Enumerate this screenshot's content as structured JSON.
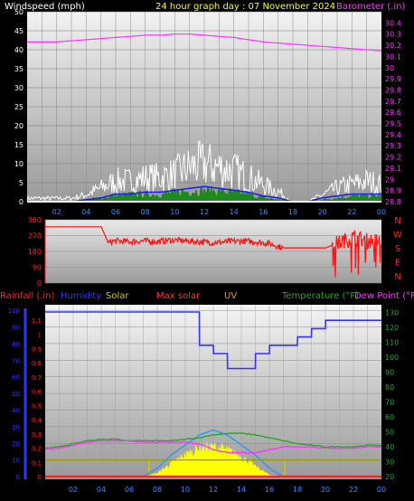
{
  "window": {
    "title": "24 hour graph day : 07 November 2024"
  },
  "colors": {
    "background": "#000000",
    "wind_label": "#ffffff",
    "title": "#ffff00",
    "barometer": "#ff33ff",
    "wind_gust": "#ffffff",
    "wind_avg": "#1a1aff",
    "wind_speed": "#118811",
    "direction": "#ff1111",
    "direction_axis": "#ff2222",
    "rainfall": "#ff2222",
    "humidity": "#3333ff",
    "solar": "#ffff00",
    "max_solar": "#ff3333",
    "uv": "#ff9900",
    "temperature": "#22aa22",
    "dewpoint": "#ff33ff",
    "max_solar_curve": "#3399ee"
  },
  "chart_data": [
    {
      "type": "line",
      "name": "wind-barometer",
      "title": "24 hour graph day : 07 November 2024",
      "ylabel": "Windspeed (mph)",
      "y2label": "Barometer (.in)",
      "x_ticks": [
        "02",
        "04",
        "06",
        "08",
        "10",
        "12",
        "14",
        "16",
        "18",
        "20",
        "22",
        "00"
      ],
      "ylim": [
        0,
        50
      ],
      "y_ticks": [
        0,
        5,
        10,
        15,
        20,
        25,
        30,
        35,
        40,
        45,
        50
      ],
      "y2lim": [
        28.8,
        30.5
      ],
      "y2_ticks": [
        "28.8",
        "28.9",
        "29",
        "29.1",
        "29.2",
        "29.3",
        "29.4",
        "29.5",
        "29.6",
        "29.7",
        "29.8",
        "29.9",
        "30",
        "30.1",
        "30.2",
        "30.3",
        "30.4"
      ],
      "series": [
        {
          "key": "barometer",
          "axis": "y2",
          "x": [
            0,
            1,
            2,
            3,
            4,
            5,
            6,
            7,
            8,
            9,
            10,
            11,
            12,
            13,
            14,
            15,
            16,
            17,
            18,
            19,
            20,
            21,
            22,
            23,
            24
          ],
          "values": [
            30.23,
            30.23,
            30.23,
            30.24,
            30.25,
            30.26,
            30.27,
            30.28,
            30.29,
            30.29,
            30.3,
            30.3,
            30.29,
            30.28,
            30.27,
            30.25,
            30.23,
            30.22,
            30.21,
            30.2,
            30.19,
            30.18,
            30.17,
            30.16,
            30.15
          ]
        },
        {
          "key": "wind_gust",
          "axis": "y",
          "x": [
            0,
            1,
            2,
            3,
            4,
            5,
            6,
            7,
            8,
            9,
            10,
            11,
            12,
            13,
            14,
            15,
            16,
            17,
            18,
            19,
            20,
            21,
            22,
            23,
            24
          ],
          "values": [
            1,
            1,
            1,
            1,
            2,
            4,
            6,
            6,
            7,
            7,
            8,
            10,
            11,
            10,
            9,
            7,
            5,
            3,
            0,
            0,
            2,
            4,
            5,
            6,
            5
          ]
        },
        {
          "key": "wind_avg",
          "axis": "y",
          "x": [
            0,
            1,
            2,
            3,
            4,
            5,
            6,
            7,
            8,
            9,
            10,
            11,
            12,
            13,
            14,
            15,
            16,
            17,
            18,
            19,
            20,
            21,
            22,
            23,
            24
          ],
          "values": [
            0,
            0,
            0,
            0,
            0.5,
            1,
            2,
            2,
            2.5,
            2.5,
            3,
            3.5,
            4,
            3.5,
            3,
            2.5,
            1.5,
            1,
            0,
            0,
            1,
            1.5,
            2,
            2,
            2
          ]
        },
        {
          "key": "wind_speed",
          "axis": "y",
          "x": [
            0,
            1,
            2,
            3,
            4,
            5,
            6,
            7,
            8,
            9,
            10,
            11,
            12,
            13,
            14,
            15,
            16,
            17,
            18,
            19,
            20,
            21,
            22,
            23,
            24
          ],
          "values": [
            0,
            0,
            0,
            0,
            0.5,
            1,
            1.5,
            2,
            2,
            2,
            2.5,
            3,
            3,
            3,
            2.5,
            2,
            1,
            0.5,
            0,
            0,
            0.5,
            1,
            1.5,
            1.5,
            1.5
          ]
        }
      ]
    },
    {
      "type": "line",
      "name": "wind-direction",
      "ylabel": "",
      "y_ticks": [
        0,
        90,
        180,
        270,
        360
      ],
      "y2_labels": [
        "N",
        "W",
        "S",
        "E",
        "N"
      ],
      "ylim": [
        0,
        360
      ],
      "series": [
        {
          "key": "direction",
          "x": [
            0,
            1,
            2,
            3,
            4,
            4.5,
            5,
            6,
            7,
            8,
            9,
            10,
            11,
            12,
            13,
            14,
            15,
            16,
            17,
            18,
            19,
            20,
            21,
            22,
            23,
            24
          ],
          "values": [
            320,
            320,
            320,
            320,
            320,
            230,
            240,
            235,
            240,
            235,
            245,
            240,
            235,
            230,
            235,
            240,
            235,
            225,
            200,
            200,
            200,
            200,
            230,
            260,
            240,
            240
          ]
        }
      ]
    },
    {
      "type": "line",
      "name": "rain-humidity-solar-temp",
      "legend": [
        "Rainfall (.in)",
        "Humidity",
        "Solar",
        "Max solar",
        "UV",
        "Temperature (°F)",
        "Dew Point (°F)"
      ],
      "y_ticks": [
        0,
        10,
        20,
        30,
        40,
        50,
        60,
        70,
        80,
        90,
        100
      ],
      "rain_ticks": [
        "0",
        "0.1",
        "0.2",
        "0.3",
        "0.4",
        "0.5",
        "0.6",
        "0.7",
        "0.8",
        "0.9",
        "1",
        "1.1"
      ],
      "temp_ticks": [
        20,
        30,
        40,
        50,
        60,
        70,
        80,
        90,
        100,
        110,
        120,
        130
      ],
      "series": [
        {
          "key": "humidity",
          "x": [
            0,
            1,
            2,
            3,
            4,
            5,
            6,
            7,
            8,
            9,
            10,
            11,
            11.01,
            12,
            12.01,
            13,
            13.01,
            15,
            15.01,
            16,
            16.01,
            18,
            18.01,
            19,
            19.01,
            20,
            20.01,
            24
          ],
          "values": [
            99,
            99,
            99,
            99,
            99,
            99,
            99,
            99,
            99,
            99,
            99,
            99,
            79,
            79,
            74,
            74,
            65,
            65,
            74,
            74,
            79,
            79,
            84,
            84,
            89,
            89,
            94,
            94
          ]
        },
        {
          "key": "temperature",
          "x": [
            0,
            1,
            2,
            3,
            4,
            5,
            6,
            7,
            8,
            9,
            10,
            11,
            12,
            13,
            14,
            15,
            16,
            17,
            18,
            19,
            20,
            21,
            22,
            23,
            24
          ],
          "values": [
            39,
            40,
            42,
            44,
            45,
            45,
            44,
            44,
            44,
            44,
            45,
            46,
            48,
            49,
            49,
            48,
            46,
            44,
            42,
            41,
            40,
            40,
            40,
            41,
            41
          ]
        },
        {
          "key": "dewpoint",
          "x": [
            0,
            1,
            2,
            3,
            4,
            5,
            6,
            7,
            8,
            9,
            10,
            11,
            12,
            13,
            14,
            15,
            16,
            17,
            18,
            19,
            20,
            21,
            22,
            23,
            24
          ],
          "values": [
            38,
            39,
            41,
            43,
            44,
            44,
            44,
            43,
            43,
            43,
            43,
            42,
            38,
            36,
            36,
            36,
            38,
            40,
            40,
            40,
            39,
            39,
            39,
            40,
            40
          ]
        },
        {
          "key": "max_solar_curve",
          "x": [
            7,
            8,
            9,
            10,
            11,
            12,
            13,
            14,
            15,
            16,
            17
          ],
          "values": [
            0,
            5,
            13,
            19,
            25,
            28,
            25,
            19,
            13,
            5,
            0
          ]
        },
        {
          "key": "solar",
          "x": [
            7,
            8,
            9,
            10,
            11,
            12,
            13,
            14,
            15,
            16,
            17
          ],
          "values": [
            0,
            2,
            8,
            13,
            17,
            18,
            16,
            12,
            6,
            1,
            0
          ]
        },
        {
          "key": "uv",
          "x": [
            0,
            24
          ],
          "values": [
            10,
            10
          ]
        },
        {
          "key": "rainfall",
          "x": [
            0,
            24
          ],
          "values": [
            0,
            0
          ]
        }
      ]
    }
  ]
}
